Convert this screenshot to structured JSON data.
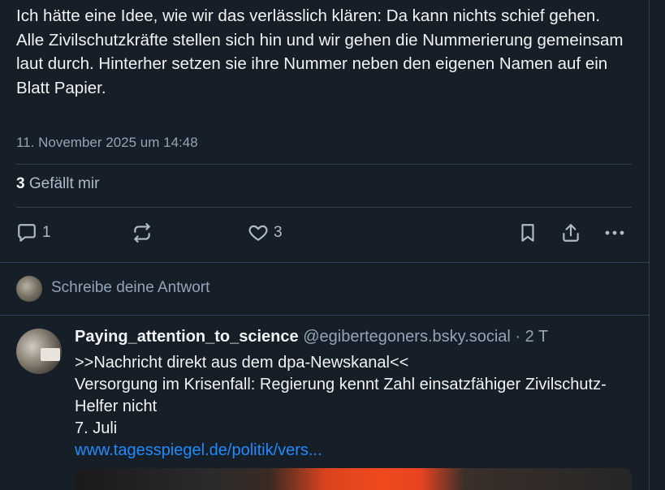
{
  "post": {
    "text_lines": [
      "Ich hätte eine Idee, wie wir das verlässlich klären: Da kann nichts schief gehen.",
      "Alle Zivilschutzkräfte stellen sich hin und wir gehen die Nummerierung gemeinsam laut durch. Hinterher setzen sie ihre Nummer neben den eigenen Namen auf ein Blatt Papier."
    ],
    "timestamp": "11. November 2025 um 14:48",
    "likes_count": "3",
    "likes_label": "Gefällt mir"
  },
  "actions": {
    "reply_count": "1",
    "repost_count": "",
    "like_count": "3",
    "icons": [
      "comment-icon",
      "repost-icon",
      "heart-icon",
      "bookmark-icon",
      "share-icon",
      "more-icon"
    ]
  },
  "composer": {
    "placeholder": "Schreibe deine Antwort"
  },
  "reply": {
    "display_name": "Paying_attention_to_science",
    "handle": "@egibertegoners.bsky.social",
    "separator": "·",
    "age": "2 T",
    "lines": [
      ">>Nachricht direkt aus dem dpa-Newskanal<<",
      "Versorgung im Krisenfall: Regierung kennt Zahl einsatzfähiger Zivilschutz-Helfer nicht",
      "7. Juli"
    ],
    "link": "www.tagesspiegel.de/politik/vers..."
  },
  "colors": {
    "background": "#161e27",
    "text": "#f1f3f5",
    "muted": "#93a5b7",
    "link": "#208bfe",
    "divider": "#2e4052"
  }
}
